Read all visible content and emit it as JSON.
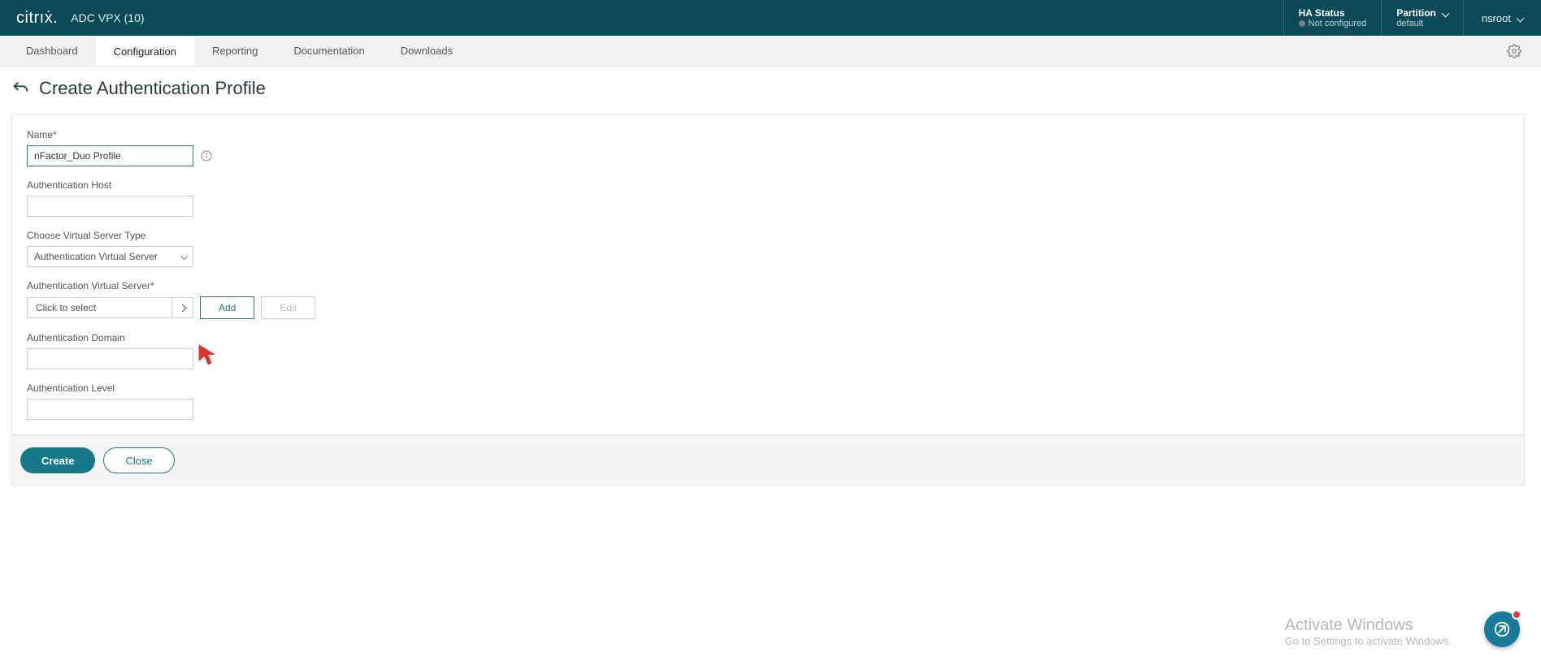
{
  "brand": {
    "logo_text": "citrıẋ.",
    "product": "ADC VPX (10)"
  },
  "topbar": {
    "ha_status": {
      "title": "HA Status",
      "sub": "Not configured"
    },
    "partition": {
      "title": "Partition",
      "sub": "default"
    },
    "user": "nsroot"
  },
  "nav": {
    "tabs": [
      {
        "label": "Dashboard"
      },
      {
        "label": "Configuration",
        "active": true
      },
      {
        "label": "Reporting"
      },
      {
        "label": "Documentation"
      },
      {
        "label": "Downloads"
      }
    ]
  },
  "page": {
    "title": "Create Authentication Profile"
  },
  "form": {
    "name_label": "Name*",
    "name_value": "nFactor_Duo Profile",
    "auth_host_label": "Authentication Host",
    "auth_host_value": "",
    "vs_type_label": "Choose Virtual Server Type",
    "vs_type_selected": "Authentication Virtual Server",
    "vs_type_options": [
      "Authentication Virtual Server"
    ],
    "auth_vs_label": "Authentication Virtual Server*",
    "auth_vs_picker_text": "Click to select",
    "add_label": "Add",
    "edit_label": "Edit",
    "auth_domain_label": "Authentication Domain",
    "auth_domain_value": "",
    "auth_level_label": "Authentication Level",
    "auth_level_value": ""
  },
  "actions": {
    "create": "Create",
    "close": "Close"
  },
  "watermark": {
    "line1": "Activate Windows",
    "line2": "Go to Settings to activate Windows."
  }
}
